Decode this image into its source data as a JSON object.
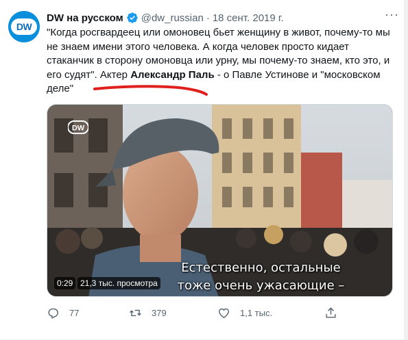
{
  "tweet": {
    "author_name": "DW на русском",
    "handle": "@dw_russian",
    "separator": "·",
    "date": "18 сент. 2019 г.",
    "avatar_text": "DW",
    "more_label": "···",
    "text_part1": "\"Когда росгвардеец или омоновец бьет женщину в живот, почему-то мы не знаем имени этого человека. А когда человек просто кидает стаканчик в сторону омоновца или урну, мы почему-то знаем, кто это, и его судят\". Актер ",
    "text_bold": "Александр Паль",
    "text_part2": " - о Павле Устинове и \"московском деле\""
  },
  "media": {
    "logo_text": "DW",
    "subtitle_line1": "Естественно, остальные",
    "subtitle_line2": "тоже очень ужасающие –",
    "duration": "0:29",
    "views": "21,3 тыс. просмотра"
  },
  "actions": {
    "replies": "77",
    "retweets": "379",
    "likes": "1,1 тыс.",
    "share": ""
  },
  "colors": {
    "accent": "#1d9bf0",
    "underline": "#e0201c",
    "muted": "#536471",
    "dw_blue": "#0a8fdc"
  }
}
